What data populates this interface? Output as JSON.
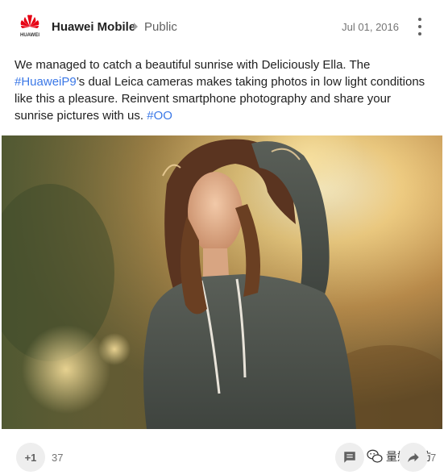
{
  "post": {
    "author": "Huawei Mobile",
    "visibility": "Public",
    "date": "Jul 01, 2016",
    "logo_text": "HUAWEI",
    "text_before": "We managed to catch a beautiful sunrise with Deliciously Ella. The ",
    "hashtag1": "#HuaweiP9",
    "text_middle": "’s dual Leica cameras makes taking photos in low light conditions like this a pleasure. Reinvent smartphone photography and share your sunrise pictures with us. ",
    "hashtag2": "#OO"
  },
  "image": {
    "description_icon": "photo-of-woman-in-sunrise"
  },
  "footer": {
    "plusone_label": "+1",
    "plusone_count": "37",
    "share_count": "7",
    "watermark_text": "量媒工坊"
  },
  "colors": {
    "link": "#3b78e7",
    "brand_red": "#e60012"
  },
  "icons": {
    "more": "more-vert-icon",
    "comment": "comment-icon",
    "share": "share-icon",
    "sep": "caret-right-icon"
  }
}
